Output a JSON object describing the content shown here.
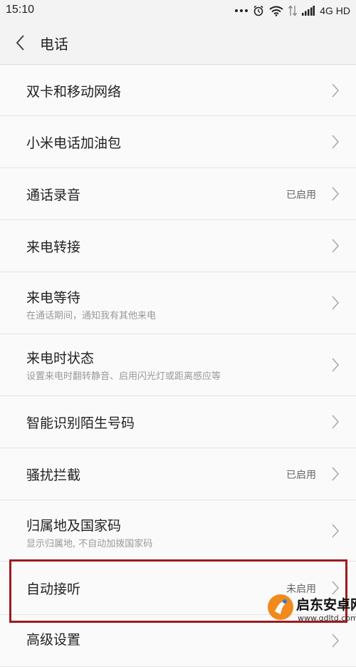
{
  "status_bar": {
    "time": "15:10",
    "network": "4G HD",
    "icons": [
      "more-dots-icon",
      "alarm-icon",
      "wifi-icon",
      "data-arrows-icon",
      "signal-icon"
    ]
  },
  "header": {
    "title": "电话",
    "back_icon": "chevron-left-icon"
  },
  "settings": [
    {
      "label": "双卡和移动网络"
    },
    {
      "label": "小米电话加油包"
    },
    {
      "label": "通话录音",
      "value": "已启用"
    },
    {
      "label": "来电转接"
    },
    {
      "label": "来电等待",
      "sub": "在通话期间，通知我有其他来电"
    },
    {
      "label": "来电时状态",
      "sub": "设置来电时翻转静音、启用闪光灯或距离感应等"
    },
    {
      "label": "智能识别陌生号码"
    },
    {
      "label": "骚扰拦截",
      "value": "已启用"
    },
    {
      "label": "归属地及国家码",
      "sub": "显示归属地, 不自动加拨国家码"
    },
    {
      "label": "自动接听",
      "value": "未启用"
    },
    {
      "label": "高级设置"
    }
  ],
  "watermark": {
    "name": "启东安卓网",
    "url": "www.qdltd.com"
  },
  "colors": {
    "highlight": "#9b1c21",
    "watermark_logo": "#f08a1c"
  }
}
